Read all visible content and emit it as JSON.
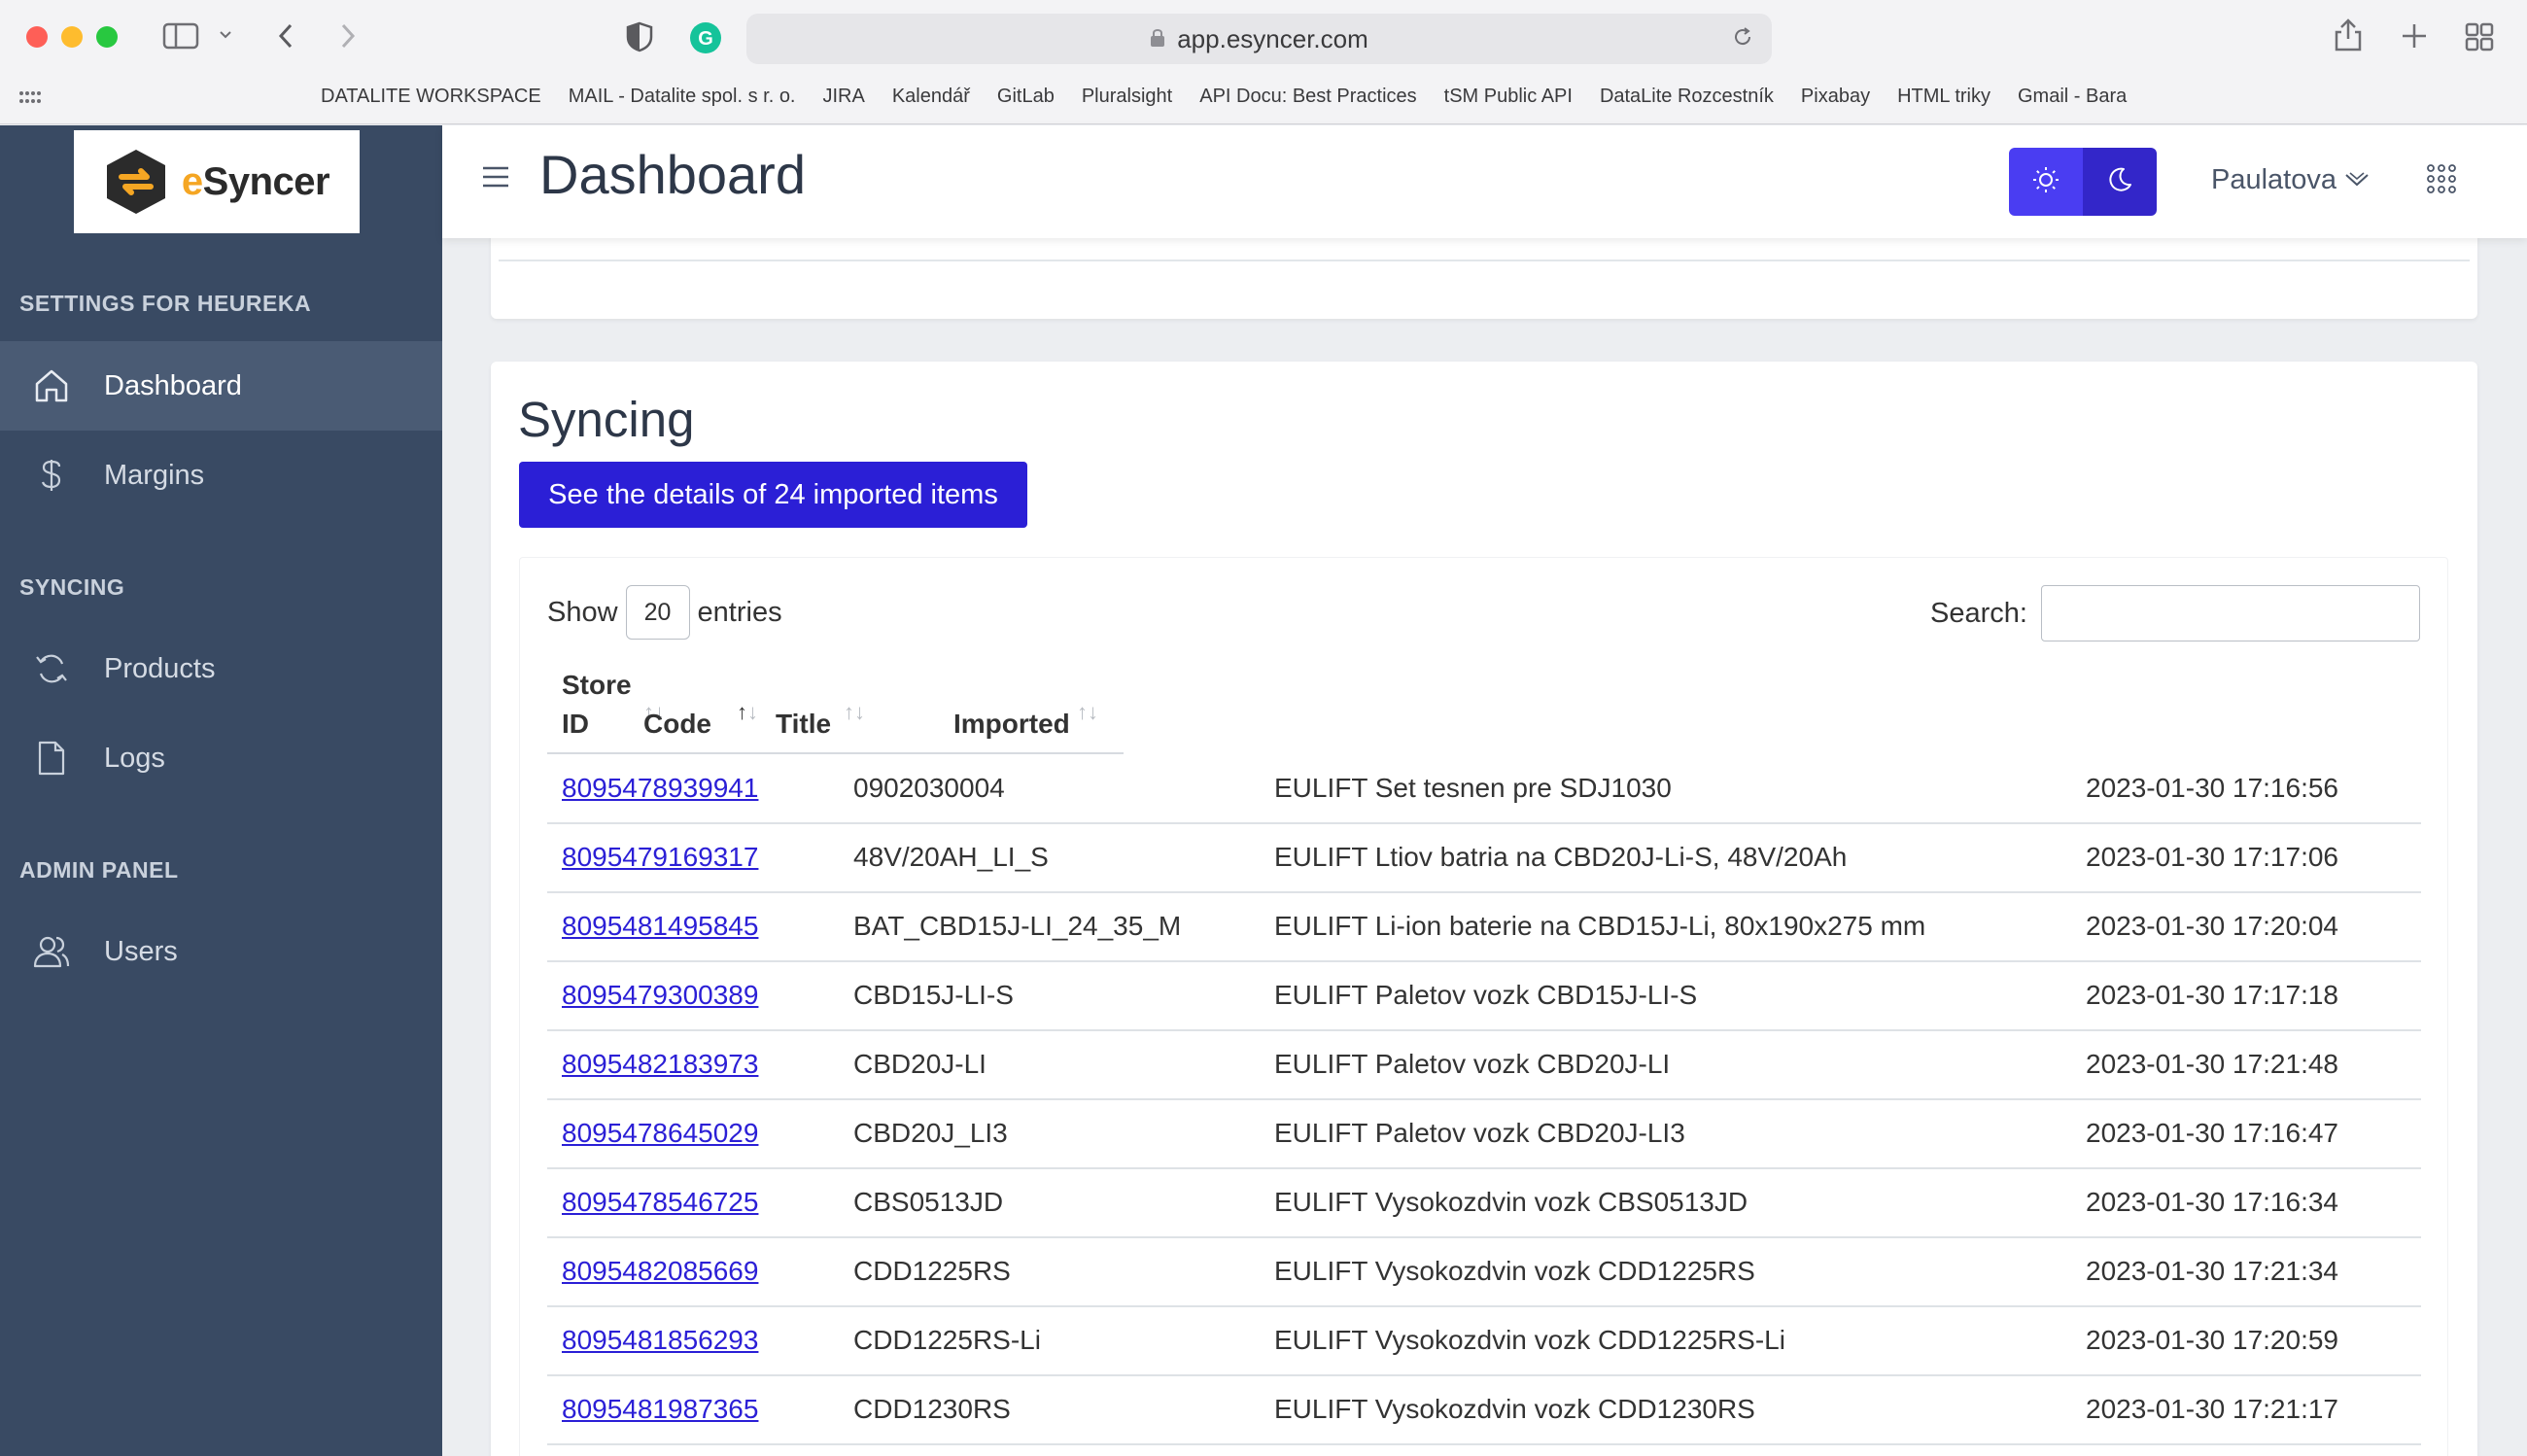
{
  "browser": {
    "url": "app.esyncer.com",
    "bookmarks": [
      "DATALITE WORKSPACE",
      "MAIL - Datalite spol. s r. o.",
      "JIRA",
      "Kalendář",
      "GitLab",
      "Pluralsight",
      "API Docu: Best Practices",
      "tSM Public API",
      "DataLite Rozcestník",
      "Pixabay",
      "HTML triky",
      "Gmail - Bara"
    ]
  },
  "brand": {
    "name_prefix": "e",
    "name_rest": "Syncer",
    "accent": "#f5a623"
  },
  "sidebar": {
    "sections": [
      {
        "heading": "SETTINGS FOR HEUREKA"
      },
      {
        "heading": "SYNCING"
      },
      {
        "heading": "ADMIN PANEL"
      }
    ],
    "items": [
      {
        "label": "Dashboard",
        "icon": "home-icon",
        "active": true
      },
      {
        "label": "Margins",
        "icon": "dollar-icon"
      },
      {
        "label": "Products",
        "icon": "sync-icon"
      },
      {
        "label": "Logs",
        "icon": "file-icon"
      },
      {
        "label": "Users",
        "icon": "users-icon"
      }
    ]
  },
  "header": {
    "title": "Dashboard",
    "user": "Paulatova"
  },
  "syncing": {
    "title": "Syncing",
    "details_button": "See the details of 24 imported items",
    "show_label": "Show",
    "page_size": "20",
    "entries_label": "entries",
    "search_label": "Search:",
    "search_value": "",
    "columns": {
      "store_id_1": "Store",
      "store_id_2": "ID",
      "code": "Code",
      "title": "Title",
      "imported": "Imported"
    },
    "rows": [
      {
        "store_id": "8095478939941",
        "code": "0902030004",
        "title": "EULIFT Set tesnen pre SDJ1030",
        "imported": "2023-01-30 17:16:56"
      },
      {
        "store_id": "8095479169317",
        "code": "48V/20AH_LI_S",
        "title": "EULIFT Ltiov batria na CBD20J-Li-S, 48V/20Ah",
        "imported": "2023-01-30 17:17:06"
      },
      {
        "store_id": "8095481495845",
        "code": "BAT_CBD15J-LI_24_35_M",
        "title": "EULIFT Li-ion baterie na CBD15J-Li, 80x190x275 mm",
        "imported": "2023-01-30 17:20:04"
      },
      {
        "store_id": "8095479300389",
        "code": "CBD15J-LI-S",
        "title": "EULIFT Paletov vozk CBD15J-LI-S",
        "imported": "2023-01-30 17:17:18"
      },
      {
        "store_id": "8095482183973",
        "code": "CBD20J-LI",
        "title": "EULIFT Paletov vozk CBD20J-LI",
        "imported": "2023-01-30 17:21:48"
      },
      {
        "store_id": "8095478645029",
        "code": "CBD20J_LI3",
        "title": "EULIFT Paletov vozk CBD20J-LI3",
        "imported": "2023-01-30 17:16:47"
      },
      {
        "store_id": "8095478546725",
        "code": "CBS0513JD",
        "title": "EULIFT Vysokozdvin vozk CBS0513JD",
        "imported": "2023-01-30 17:16:34"
      },
      {
        "store_id": "8095482085669",
        "code": "CDD1225RS",
        "title": "EULIFT Vysokozdvin vozk CDD1225RS",
        "imported": "2023-01-30 17:21:34"
      },
      {
        "store_id": "8095481856293",
        "code": "CDD1225RS-Li",
        "title": "EULIFT Vysokozdvin vozk CDD1225RS-Li",
        "imported": "2023-01-30 17:20:59"
      },
      {
        "store_id": "8095481987365",
        "code": "CDD1230RS",
        "title": "EULIFT Vysokozdvin vozk CDD1230RS",
        "imported": "2023-01-30 17:21:17"
      }
    ]
  }
}
